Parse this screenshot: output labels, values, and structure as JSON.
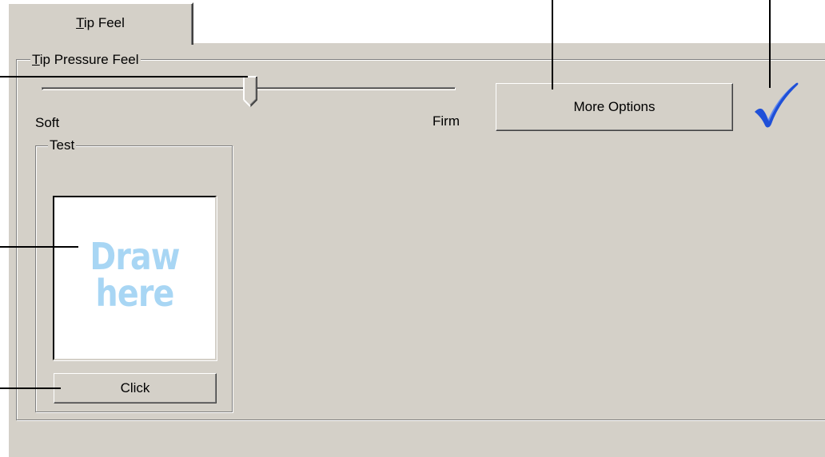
{
  "tab": {
    "label": "Tip Feel",
    "mnemonic": "T",
    "rest": "ip Feel"
  },
  "tip_pressure_group": {
    "legend": "Tip Pressure Feel",
    "mnemonic": "T",
    "rest": "ip Pressure Feel"
  },
  "slider": {
    "min_label": "Soft",
    "max_label": "Firm",
    "value_fraction": 0.5
  },
  "buttons": {
    "more_options": "More Options",
    "click": "Click"
  },
  "test_group": {
    "legend": "Test"
  },
  "draw_area": {
    "line1": "Draw",
    "line2": "here"
  },
  "icons": {
    "checkmark": "checkmark-icon"
  },
  "colors": {
    "dialog_face": "#d4d0c8",
    "draw_here_text": "#a8d6f4",
    "checkmark_blue": "#1f50d8"
  }
}
